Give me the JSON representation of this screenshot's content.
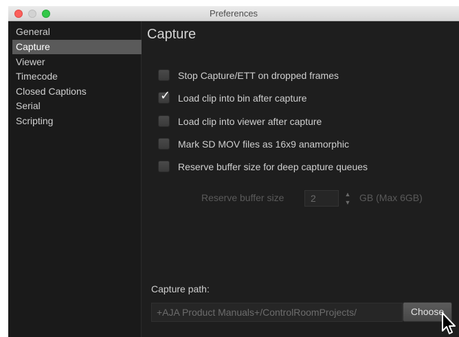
{
  "window": {
    "title": "Preferences"
  },
  "sidebar": {
    "items": [
      {
        "label": "General",
        "selected": false
      },
      {
        "label": "Capture",
        "selected": true
      },
      {
        "label": "Viewer",
        "selected": false
      },
      {
        "label": "Timecode",
        "selected": false
      },
      {
        "label": "Closed Captions",
        "selected": false
      },
      {
        "label": "Serial",
        "selected": false
      },
      {
        "label": "Scripting",
        "selected": false
      }
    ]
  },
  "capture": {
    "title": "Capture",
    "options": [
      {
        "label": "Stop Capture/ETT on dropped frames",
        "checked": false
      },
      {
        "label": "Load clip into bin after capture",
        "checked": true
      },
      {
        "label": "Load clip into viewer after capture",
        "checked": false
      },
      {
        "label": "Mark SD MOV files as 16x9 anamorphic",
        "checked": false
      },
      {
        "label": "Reserve buffer size for deep capture queues",
        "checked": false
      }
    ],
    "buffer": {
      "label": "Reserve buffer size",
      "value": "2",
      "unit": "GB (Max 6GB)"
    },
    "path_label": "Capture path:",
    "path_value": "+AJA Product Manuals+/ControlRoomProjects/",
    "choose_label": "Choose"
  },
  "icons": {
    "check": "checkmark-icon",
    "stepper": "stepper-icon",
    "cursor": "mouse-cursor-icon"
  }
}
